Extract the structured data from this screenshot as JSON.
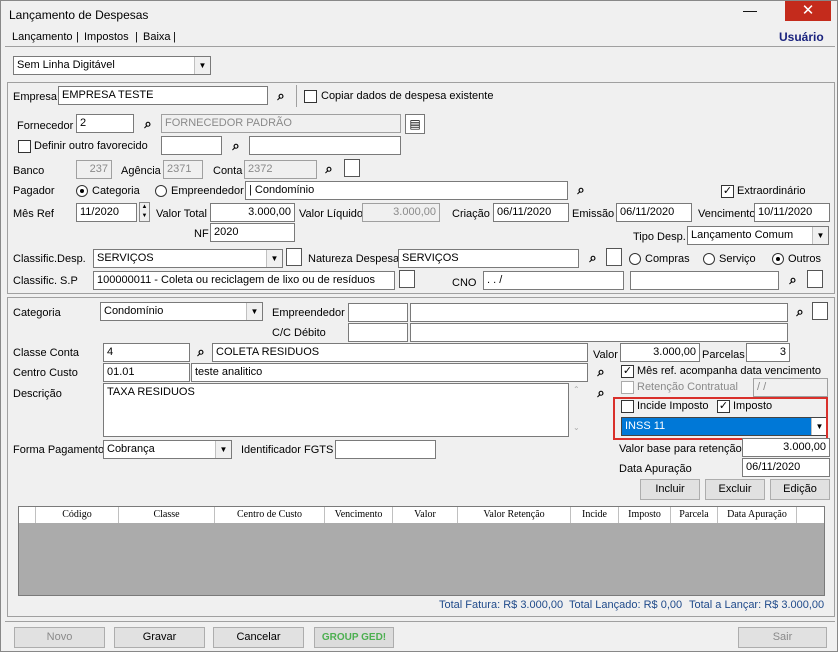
{
  "window": {
    "title": "Lançamento de Despesas",
    "min": "—",
    "close": "✕"
  },
  "tabs": [
    "Lançamento",
    "Impostos",
    "Baixa"
  ],
  "user_label": "Usuário",
  "linha_digitavel": "Sem Linha Digitável",
  "empresa": {
    "label": "Empresa",
    "value": "EMPRESA TESTE",
    "copy_label": "Copiar dados de despesa existente"
  },
  "fornecedor": {
    "label": "Fornecedor",
    "code": "2",
    "name": "FORNECEDOR PADRÃO"
  },
  "favorecido": {
    "label": "Definir outro favorecido"
  },
  "banco": {
    "label": "Banco",
    "value": "237",
    "agencia_label": "Agência",
    "agencia": "2371",
    "conta_label": "Conta",
    "conta": "2372"
  },
  "pagador": {
    "label": "Pagador",
    "opt1": "Categoria",
    "opt2": "Empreendedor",
    "value": "| Condomínio",
    "extra_label": "Extraordinário"
  },
  "datas": {
    "mesref_label": "Mês Ref",
    "mesref": "11/2020",
    "vtotal_label": "Valor Total",
    "vtotal": "3.000,00",
    "vliq_label": "Valor Líquido",
    "vliq": "3.000,00",
    "criacao_label": "Criação",
    "criacao": "06/11/2020",
    "emissao_label": "Emissão",
    "emissao": "06/11/2020",
    "venc_label": "Vencimento",
    "venc": "10/11/2020",
    "nf_label": "NF",
    "nf": "2020"
  },
  "tipo_desp": {
    "label": "Tipo Desp.",
    "value": "Lançamento Comum"
  },
  "classif": {
    "desp_label": "Classific.Desp.",
    "desp": "SERVIÇOS",
    "natureza_label": "Natureza Despesa",
    "natureza": "SERVIÇOS",
    "compras": "Compras",
    "servico": "Serviço",
    "outros": "Outros",
    "sp_label": "Classific. S.P",
    "sp": "100000011 - Coleta ou reciclagem de lixo ou de resíduos",
    "cno_label": "CNO",
    "cno": ". . /"
  },
  "lower": {
    "categoria_label": "Categoria",
    "categoria": "Condomínio",
    "empreendedor_label": "Empreendedor",
    "cc_label": "C/C Débito",
    "classe_label": "Classe Conta",
    "classe_code": "4",
    "classe_name": "COLETA RESIDUOS",
    "valor_label": "Valor",
    "valor": "3.000,00",
    "parcelas_label": "Parcelas",
    "parcelas": "3",
    "centro_label": "Centro Custo",
    "centro_code": "01.01",
    "centro_name": "teste analitico",
    "mesref_acomp": "Mês ref. acompanha data vencimento",
    "descricao_label": "Descrição",
    "descricao": "TAXA RESIDUOS",
    "retencao_label": "Retenção Contratual",
    "retencao_value": "/ /",
    "incide_label": "Incide Imposto",
    "imposto_label": "Imposto",
    "imposto_value": "INSS 11",
    "forma_label": "Forma Pagamento",
    "forma": "Cobrança",
    "fgts_label": "Identificador FGTS",
    "vbase_label": "Valor base para retenção",
    "vbase": "3.000,00",
    "apuracao_label": "Data Apuração",
    "apuracao": "06/11/2020"
  },
  "actions": {
    "incluir": "Incluir",
    "excluir": "Excluir",
    "edicao": "Edição"
  },
  "grid_headers": [
    "Código",
    "Classe",
    "Centro de Custo",
    "Vencimento",
    "Valor",
    "Valor Retenção",
    "Incide",
    "Imposto",
    "Parcela",
    "Data Apuração"
  ],
  "totals": {
    "fatura": "Total Fatura: R$ 3.000,00",
    "lancado": "Total Lançado: R$ 0,00",
    "lancar": "Total a Lançar: R$ 3.000,00"
  },
  "footer": {
    "novo": "Novo",
    "gravar": "Gravar",
    "cancelar": "Cancelar",
    "logo": "GROUP GED!",
    "sair": "Sair"
  }
}
